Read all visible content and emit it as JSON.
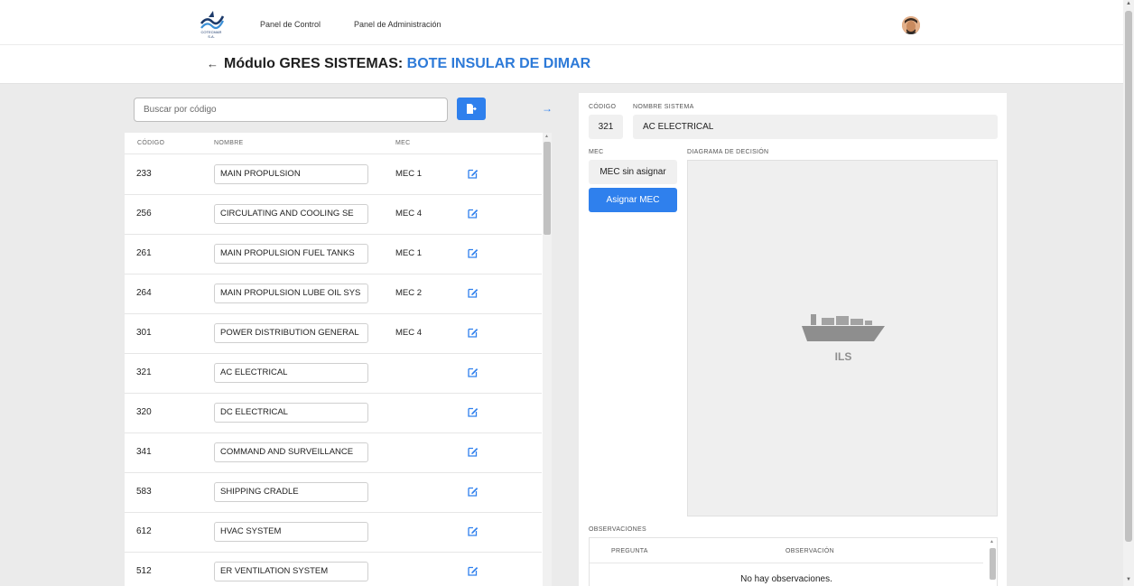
{
  "nav": {
    "logo_text": "COTECMAR S.A.",
    "links": [
      "Panel de Control",
      "Panel de Administración"
    ]
  },
  "header": {
    "back_icon": "arrow-left-icon",
    "title_prefix": "Módulo GRES SISTEMAS:",
    "title_accent": "BOTE INSULAR DE DIMAR"
  },
  "search": {
    "placeholder": "Buscar por código",
    "value": ""
  },
  "list": {
    "columns": [
      "CÓDIGO",
      "NOMBRE",
      "MEC"
    ],
    "rows": [
      {
        "code": "233",
        "name": "MAIN PROPULSION",
        "mec": "MEC 1"
      },
      {
        "code": "256",
        "name": "CIRCULATING AND COOLING SE",
        "mec": "MEC 4"
      },
      {
        "code": "261",
        "name": "MAIN PROPULSION FUEL TANKS",
        "mec": "MEC 1"
      },
      {
        "code": "264",
        "name": "MAIN PROPULSION LUBE OIL SYS",
        "mec": "MEC 2"
      },
      {
        "code": "301",
        "name": "POWER DISTRIBUTION GENERAL",
        "mec": "MEC 4"
      },
      {
        "code": "321",
        "name": "AC ELECTRICAL",
        "mec": ""
      },
      {
        "code": "320",
        "name": "DC ELECTRICAL",
        "mec": ""
      },
      {
        "code": "341",
        "name": "COMMAND AND SURVEILLANCE",
        "mec": ""
      },
      {
        "code": "583",
        "name": "SHIPPING CRADLE",
        "mec": ""
      },
      {
        "code": "612",
        "name": "HVAC SYSTEM",
        "mec": ""
      },
      {
        "code": "512",
        "name": "ER VENTILATION SYSTEM",
        "mec": ""
      }
    ]
  },
  "detail": {
    "code_label": "CÓDIGO",
    "code_value": "321",
    "name_label": "NOMBRE SISTEMA",
    "name_value": "AC ELECTRICAL",
    "mec_label": "MEC",
    "mec_value": "MEC sin asignar",
    "assign_button": "Asignar MEC",
    "diagram_label": "DIAGRAMA DE DECISIÓN",
    "diagram_logo_text": "ILS",
    "observations_label": "OBSERVACIONES",
    "obs_columns": [
      "PREGUNTA",
      "OBSERVACIÓN"
    ],
    "obs_empty": "No hay observaciones."
  },
  "colors": {
    "accent": "#2d7ad8",
    "button": "#2f80ed"
  }
}
